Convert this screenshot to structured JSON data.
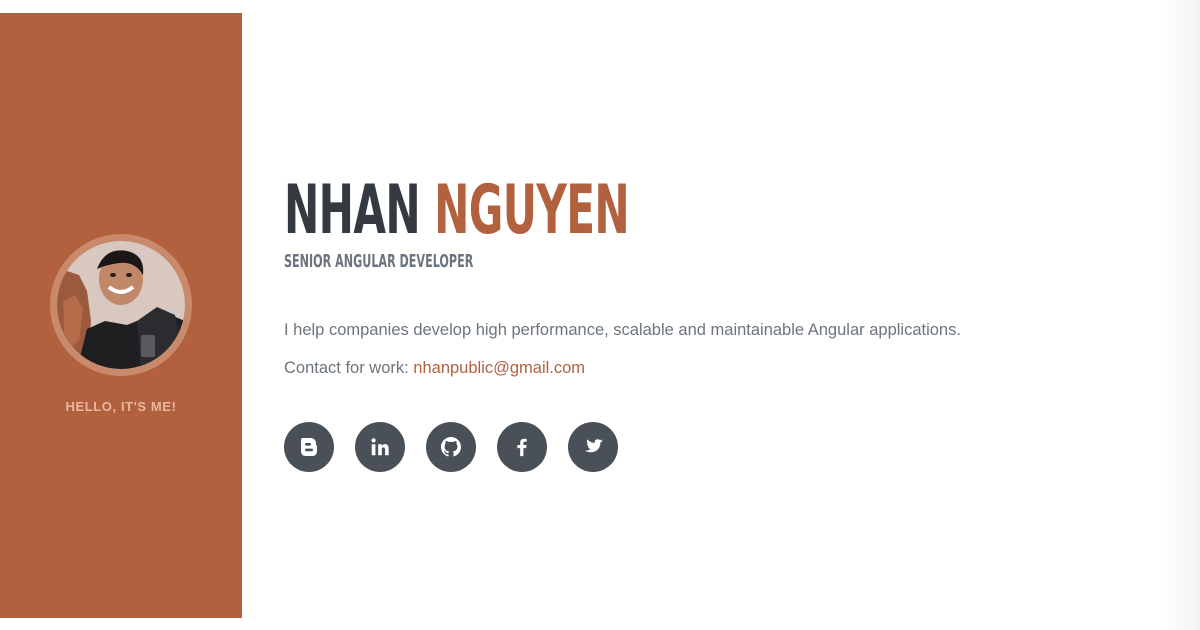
{
  "sidebar": {
    "greeting": "HELLO, IT'S ME!",
    "avatar_alt": "avatar"
  },
  "header": {
    "first_name": "NHAN",
    "last_name": "NGUYEN",
    "subtitle": "SENIOR ANGULAR DEVELOPER"
  },
  "about": {
    "lead": "I help companies develop high performance, scalable and maintainable Angular applications.",
    "contact_label": "Contact for work: ",
    "contact_email": "nhanpublic@gmail.com"
  },
  "socials": [
    {
      "name": "blogger",
      "icon": "blogger-icon"
    },
    {
      "name": "linkedin",
      "icon": "linkedin-icon"
    },
    {
      "name": "github",
      "icon": "github-icon"
    },
    {
      "name": "facebook",
      "icon": "facebook-icon"
    },
    {
      "name": "twitter",
      "icon": "twitter-icon"
    }
  ],
  "colors": {
    "accent": "#b2613e",
    "dark": "#343a40",
    "muted": "#6c757d",
    "social_bg": "#495057"
  }
}
